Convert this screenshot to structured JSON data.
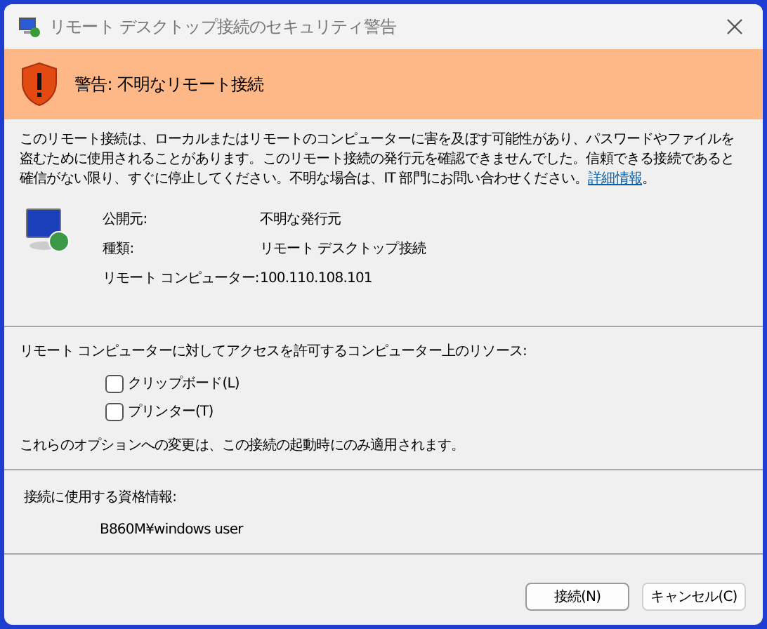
{
  "window": {
    "title": "リモート デスクトップ接続のセキュリティ警告"
  },
  "banner": {
    "title": "警告: 不明なリモート接続"
  },
  "message": {
    "text": "このリモート接続は、ローカルまたはリモートのコンピューターに害を及ぼす可能性があり、パスワードやファイルを盗むために使用されることがあります。このリモート接続の発行元を確認できませんでした。信頼できる接続であると確信がない限り、すぐに停止してください。不明な場合は、IT 部門にお問い合わせください。",
    "link": "詳細情報",
    "tail": "。"
  },
  "details": [
    {
      "label": "公開元:",
      "value": "不明な発行元"
    },
    {
      "label": "種類:",
      "value": "リモート デスクトップ接続"
    },
    {
      "label": "リモート コンピューター:",
      "value": "100.110.108.101"
    }
  ],
  "resources": {
    "heading": "リモート コンピューターに対してアクセスを許可するコンピューター上のリソース:",
    "options": [
      {
        "label": "クリップボード(L)",
        "checked": false
      },
      {
        "label": "プリンター(T)",
        "checked": false
      }
    ],
    "note": "これらのオプションへの変更は、この接続の起動時にのみ適用されます。"
  },
  "credentials": {
    "heading": "接続に使用する資格情報:",
    "user": "B860M¥windows user"
  },
  "buttons": [
    {
      "label": "接続(N)",
      "selected": true
    },
    {
      "label": "キャンセル(C)",
      "selected": false
    }
  ]
}
